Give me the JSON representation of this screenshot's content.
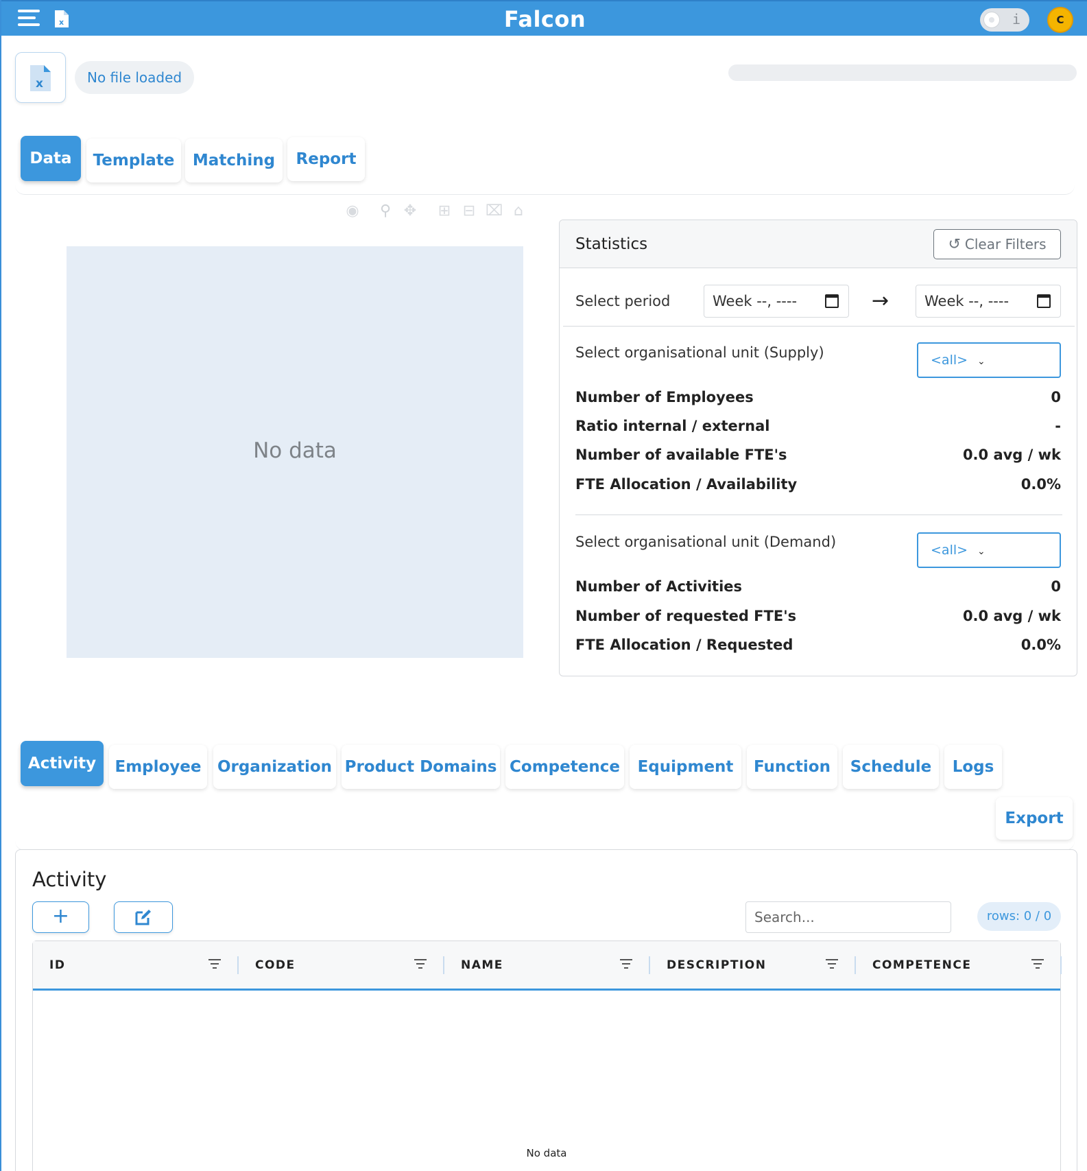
{
  "app": {
    "title": "Falcon",
    "avatar_letter": "C",
    "toggle_info": "i"
  },
  "file": {
    "status": "No file loaded"
  },
  "progress": {
    "value": 0
  },
  "main_tabs": [
    {
      "label": "Data",
      "active": true
    },
    {
      "label": "Template",
      "active": false
    },
    {
      "label": "Matching",
      "active": false
    },
    {
      "label": "Report",
      "active": false
    }
  ],
  "plot": {
    "toolbar_icons": [
      "camera-icon",
      "zoom-icon",
      "pan-icon",
      "zoom-in-icon",
      "zoom-out-icon",
      "autoscale-icon",
      "reset-home-icon"
    ],
    "empty_text": "No data"
  },
  "statistics": {
    "title": "Statistics",
    "clear_filters": "Clear Filters",
    "select_period": "Select period",
    "week_from": "Week --, ----",
    "week_to": "Week --, ----",
    "supply_label": "Select organisational unit (Supply)",
    "supply_value": "<all>",
    "supply_rows": [
      {
        "label": "Number of Employees",
        "value": "0"
      },
      {
        "label": "Ratio internal / external",
        "value": "-"
      },
      {
        "label": "Number of available FTE's",
        "value": "0.0 avg / wk"
      },
      {
        "label": "FTE Allocation / Availability",
        "value": "0.0%"
      }
    ],
    "demand_label": "Select organisational unit (Demand)",
    "demand_value": "<all>",
    "demand_rows": [
      {
        "label": "Number of Activities",
        "value": "0"
      },
      {
        "label": "Number of requested FTE's",
        "value": "0.0 avg / wk"
      },
      {
        "label": "FTE Allocation / Requested",
        "value": "0.0%"
      }
    ]
  },
  "entity_tabs": [
    {
      "label": "Activity",
      "active": true
    },
    {
      "label": "Employee",
      "active": false
    },
    {
      "label": "Organization",
      "active": false
    },
    {
      "label": "Product Domains",
      "active": false
    },
    {
      "label": "Competence",
      "active": false
    },
    {
      "label": "Equipment",
      "active": false
    },
    {
      "label": "Function",
      "active": false
    },
    {
      "label": "Schedule",
      "active": false
    },
    {
      "label": "Logs",
      "active": false
    }
  ],
  "export_label": "Export",
  "table_panel": {
    "title": "Activity",
    "add_icon": "plus-icon",
    "edit_icon": "edit-icon",
    "search_placeholder": "Search...",
    "rows_badge": "rows: 0 / 0",
    "columns": [
      "ID",
      "CODE",
      "NAME",
      "DESCRIPTION",
      "COMPETENCE"
    ],
    "empty_text": "No data"
  },
  "colors": {
    "brand": "#3c97dd",
    "avatar": "#f5b400",
    "plot_bg": "#e5edf6"
  }
}
